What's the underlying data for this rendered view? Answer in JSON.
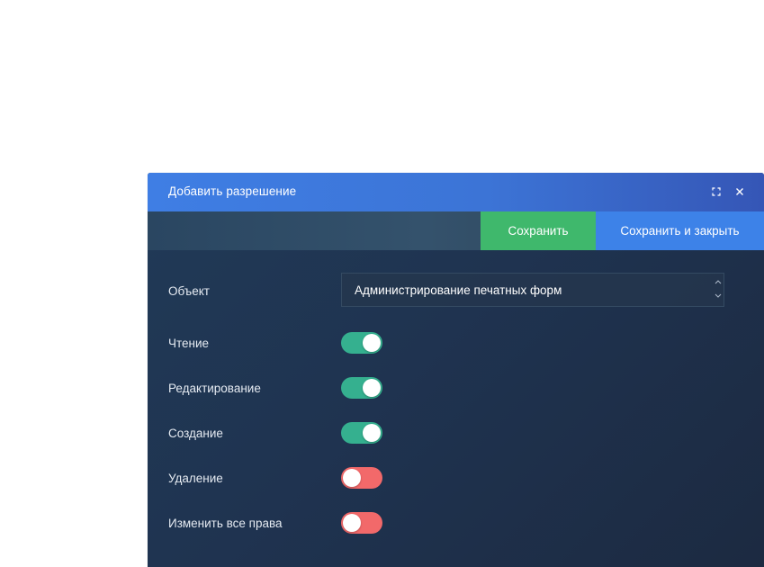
{
  "dialog": {
    "title": "Добавить разрешение",
    "icons": {
      "maximize": "maximize-icon",
      "close": "close-icon"
    }
  },
  "toolbar": {
    "save_label": "Сохранить",
    "save_close_label": "Сохранить и закрыть"
  },
  "form": {
    "object_label": "Объект",
    "object_value": "Администрирование печатных форм",
    "permissions": [
      {
        "label": "Чтение",
        "enabled": true
      },
      {
        "label": "Редактирование",
        "enabled": true
      },
      {
        "label": "Создание",
        "enabled": true
      },
      {
        "label": "Удаление",
        "enabled": false
      },
      {
        "label": "Изменить все права",
        "enabled": false
      }
    ]
  },
  "colors": {
    "title_bar": "#3f7ee4",
    "save_button": "#3fb86c",
    "save_close_button": "#3d82e8",
    "toggle_on": "#35b08f",
    "toggle_off": "#f2696a"
  }
}
